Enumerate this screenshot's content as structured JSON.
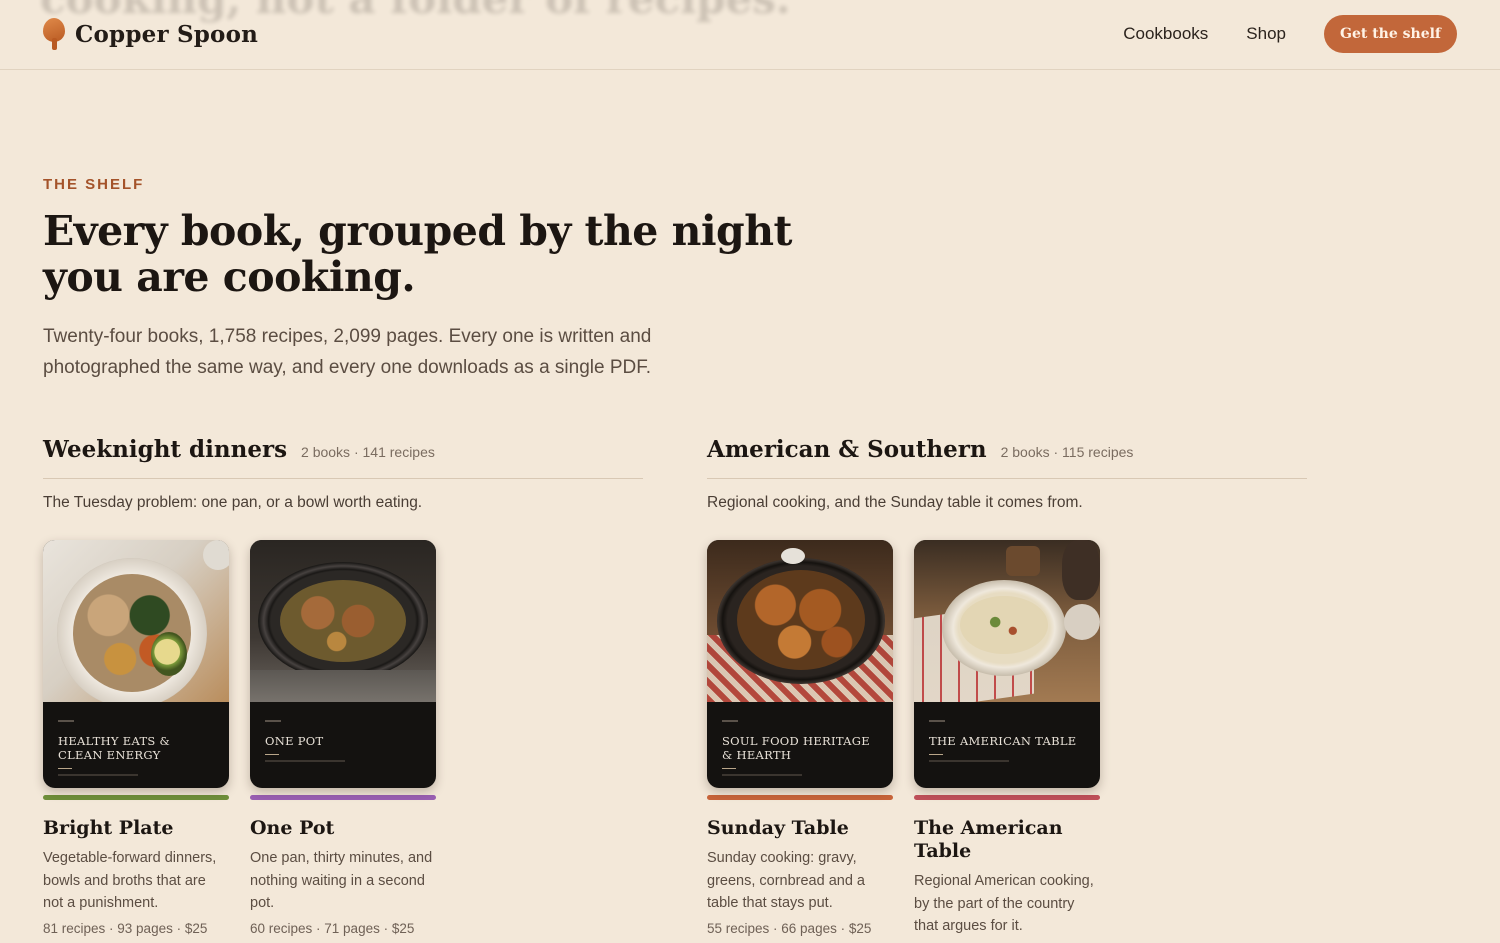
{
  "header": {
    "ghost_text": "cooking, not a folder of recipes.",
    "brand": "Copper Spoon",
    "nav": [
      "Cookbooks",
      "Shop"
    ],
    "cta": "Get the shelf"
  },
  "hero": {
    "eyebrow": "THE SHELF",
    "title": "Every book, grouped by the night you are cooking.",
    "lead": "Twenty-four books, 1,758 recipes, 2,099 pages. Every one is written and photographed the same way, and every one downloads as a single PDF."
  },
  "sections": [
    {
      "title": "Weeknight dinners",
      "meta": "2 books · 141 recipes",
      "description": "The Tuesday problem: one pan, or a bowl worth eating.",
      "books": [
        {
          "cover_title": "HEALTHY EATS & CLEAN ENERGY",
          "title": "Bright Plate",
          "description": "Vegetable-forward dinners, bowls and broths that are not a punishment.",
          "meta": "81 recipes · 93 pages · $25",
          "accent": "#6f8f3a"
        },
        {
          "cover_title": "ONE POT",
          "title": "One Pot",
          "description": "One pan, thirty minutes, and nothing waiting in a second pot.",
          "meta": "60 recipes · 71 pages · $25",
          "accent": "#9a5fb3"
        }
      ]
    },
    {
      "title": "American & Southern",
      "meta": "2 books · 115 recipes",
      "description": "Regional cooking, and the Sunday table it comes from.",
      "books": [
        {
          "cover_title": "SOUL FOOD HERITAGE & HEARTH",
          "title": "Sunday Table",
          "description": "Sunday cooking: gravy, greens, cornbread and a table that stays put.",
          "meta": "55 recipes · 66 pages · $25",
          "accent": "#c8643a"
        },
        {
          "cover_title": "THE AMERICAN TABLE",
          "title": "The American Table",
          "description": "Regional American cooking, by the part of the country that argues for it.",
          "meta": "",
          "accent": "#c0505a"
        }
      ]
    }
  ]
}
